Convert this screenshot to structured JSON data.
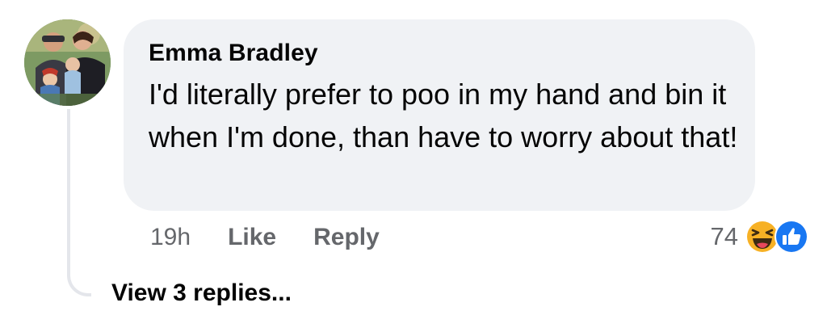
{
  "comment": {
    "author": "Emma Bradley",
    "text": "I'd literally prefer to poo in my hand and bin it when I'm done, than have to worry about that!",
    "avatar_icon": "avatar-photo"
  },
  "actions": {
    "timestamp": "19h",
    "like_label": "Like",
    "reply_label": "Reply"
  },
  "reactions": {
    "count": "74",
    "icons": [
      "haha-icon",
      "like-icon"
    ]
  },
  "replies": {
    "label": "View 3 replies..."
  },
  "colors": {
    "bubble": "#f0f2f5",
    "text": "#050505",
    "secondary": "#65676b",
    "like_blue": "#1877f2",
    "haha_yellow": "#f7b125"
  }
}
